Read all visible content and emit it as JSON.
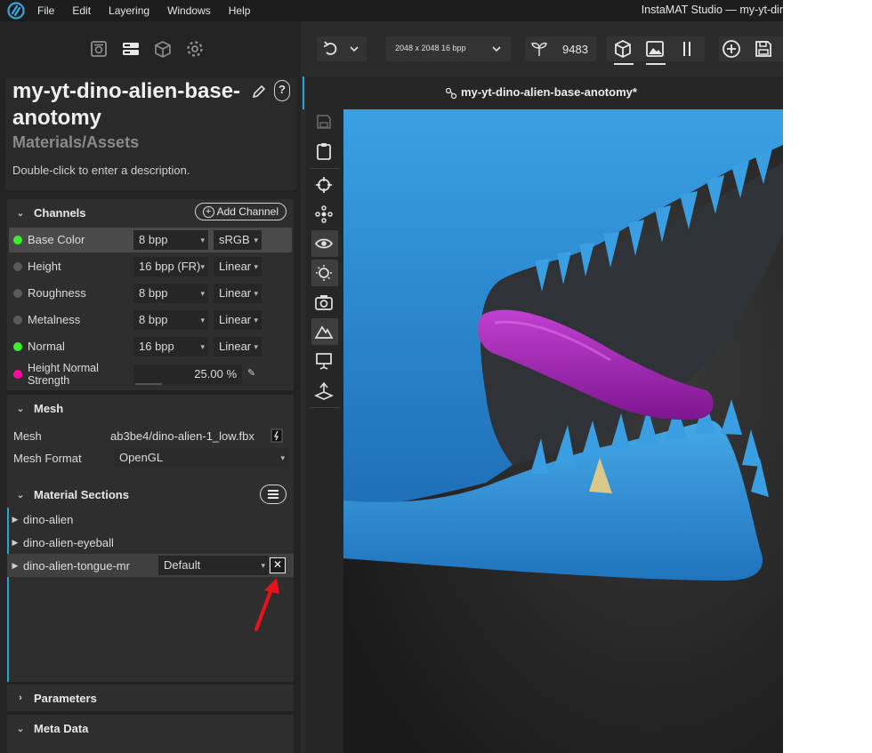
{
  "menubar": {
    "items": [
      "File",
      "Edit",
      "Layering",
      "Windows",
      "Help"
    ],
    "window_title": "InstaMAT Studio — my-yt-dir"
  },
  "asset": {
    "title": "my-yt-dino-alien-base-anotomy",
    "subtitle": "Materials/Assets",
    "description": "Double-click to enter a description.",
    "help_label": "?"
  },
  "channels": {
    "header": "Channels",
    "add_label": "Add Channel",
    "rows": [
      {
        "name": "Base Color",
        "bpp": "8 bpp",
        "space": "sRGB",
        "dot": "green"
      },
      {
        "name": "Height",
        "bpp": "16 bpp (FR)",
        "space": "Linear",
        "dot": "grey"
      },
      {
        "name": "Roughness",
        "bpp": "8 bpp",
        "space": "Linear",
        "dot": "grey"
      },
      {
        "name": "Metalness",
        "bpp": "8 bpp",
        "space": "Linear",
        "dot": "grey"
      },
      {
        "name": "Normal",
        "bpp": "16 bpp",
        "space": "Linear",
        "dot": "green"
      }
    ],
    "height_normal": {
      "name": "Height Normal Strength",
      "value": "25.00 %"
    }
  },
  "mesh": {
    "header": "Mesh",
    "mesh_label": "Mesh",
    "mesh_value": "ab3be4/dino-alien-1_low.fbx",
    "format_label": "Mesh Format",
    "format_value": "OpenGL"
  },
  "material_sections": {
    "header": "Material Sections",
    "items": [
      {
        "name": "dino-alien"
      },
      {
        "name": "dino-alien-eyeball"
      },
      {
        "name": "dino-alien-tongue-mr",
        "value": "Default"
      }
    ]
  },
  "parameters": {
    "header": "Parameters"
  },
  "meta_data": {
    "header": "Meta Data"
  },
  "toolbar": {
    "resolution": "2048 x 2048 16 bpp",
    "seed": "9483"
  },
  "document": {
    "tab_title": "my-yt-dino-alien-base-anotomy*"
  },
  "colors": {
    "accent": "#2aa3d8",
    "dot_green": "#3cf02d",
    "dot_pink": "#ff0aa0",
    "annotation_arrow": "#e8121c",
    "dino_blue": "#2e8fd6",
    "tongue_purple": "#a124b4"
  }
}
